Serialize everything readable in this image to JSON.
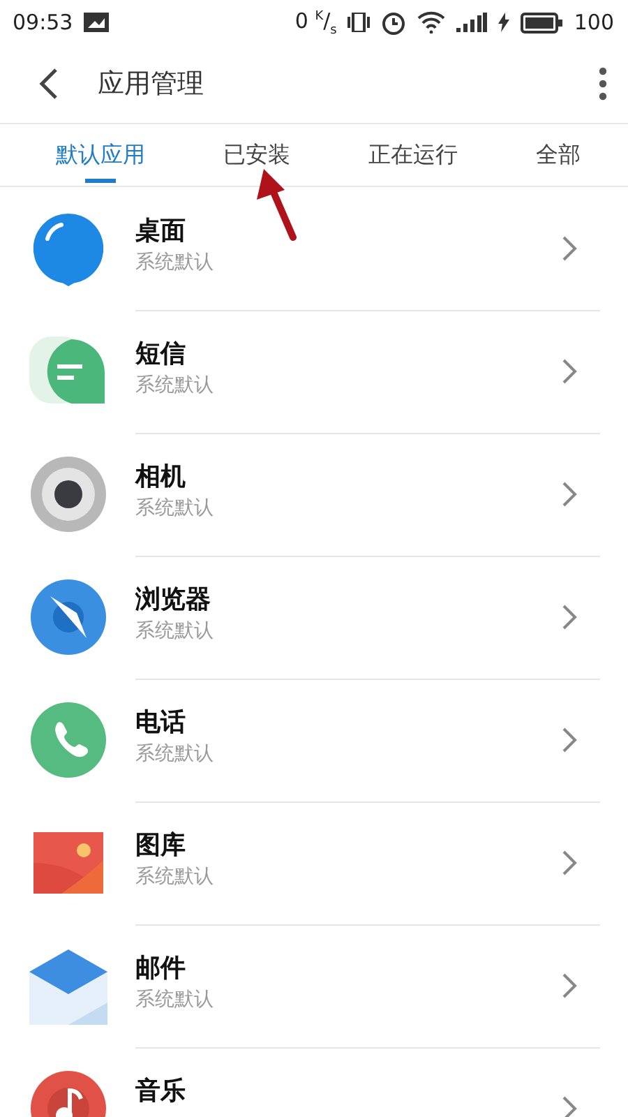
{
  "status_bar": {
    "time": "09:53",
    "speed": "0 $^{K}$/$_{s}$",
    "battery": "100"
  },
  "header": {
    "title": "应用管理"
  },
  "tabs": [
    {
      "label": "默认应用",
      "selected": true
    },
    {
      "label": "已安装",
      "selected": false
    },
    {
      "label": "正在运行",
      "selected": false
    },
    {
      "label": "全部",
      "selected": false
    }
  ],
  "apps": [
    {
      "name": "桌面",
      "subtitle": "系统默认"
    },
    {
      "name": "短信",
      "subtitle": "系统默认"
    },
    {
      "name": "相机",
      "subtitle": "系统默认"
    },
    {
      "name": "浏览器",
      "subtitle": "系统默认"
    },
    {
      "name": "电话",
      "subtitle": "系统默认"
    },
    {
      "name": "图库",
      "subtitle": "系统默认"
    },
    {
      "name": "邮件",
      "subtitle": "系统默认"
    },
    {
      "name": "音乐"
    }
  ]
}
